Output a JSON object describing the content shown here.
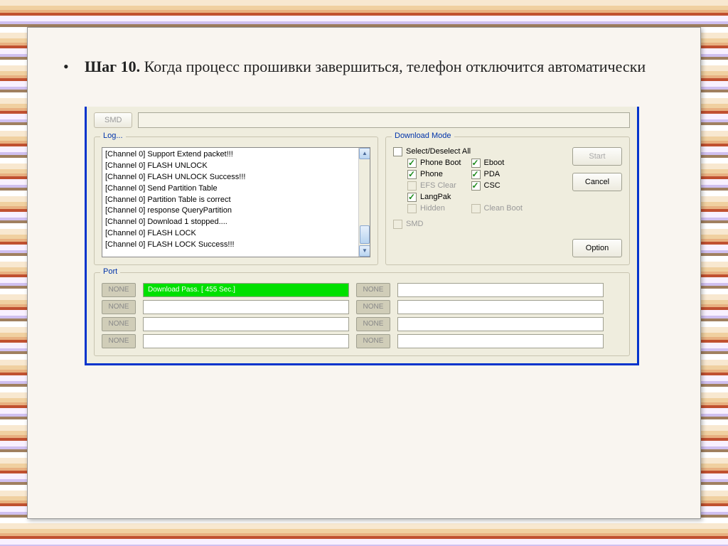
{
  "heading": {
    "bold": "Шаг 10.",
    "rest": " Когда процесс прошивки завершиться, телефон отключится автоматически"
  },
  "smd": {
    "button": "SMD"
  },
  "log": {
    "title": "Log...",
    "lines": [
      "[Channel 0] Support Extend packet!!!",
      "[Channel 0]  FLASH UNLOCK",
      "[Channel 0]  FLASH UNLOCK Success!!!",
      "[Channel 0]  Send Partition Table",
      "[Channel 0]  Partition Table is correct",
      "[Channel 0] response QueryPartition",
      "[Channel 0]  Download 1 stopped....",
      "[Channel 0]  FLASH LOCK",
      "[Channel 0]  FLASH LOCK Success!!!"
    ]
  },
  "download": {
    "title": "Download Mode",
    "selectAll": "Select/Deselect All",
    "col1": [
      {
        "label": "Phone Boot",
        "checked": true,
        "enabled": true
      },
      {
        "label": "Phone",
        "checked": true,
        "enabled": true
      },
      {
        "label": "EFS Clear",
        "checked": false,
        "enabled": false
      },
      {
        "label": "LangPak",
        "checked": true,
        "enabled": true
      },
      {
        "label": "Hidden",
        "checked": false,
        "enabled": false
      }
    ],
    "col2": [
      {
        "label": "Eboot",
        "checked": true,
        "enabled": true
      },
      {
        "label": "PDA",
        "checked": true,
        "enabled": true
      },
      {
        "label": "CSC",
        "checked": true,
        "enabled": true
      },
      {
        "label": "",
        "checked": false,
        "enabled": false
      },
      {
        "label": "Clean Boot",
        "checked": false,
        "enabled": false
      }
    ],
    "smdRow": {
      "label": "SMD",
      "checked": false,
      "enabled": false
    },
    "buttons": {
      "start": "Start",
      "cancel": "Cancel",
      "option": "Option"
    }
  },
  "port": {
    "title": "Port",
    "labels": [
      "NONE",
      "NONE",
      "NONE",
      "NONE"
    ],
    "labels2": [
      "NONE",
      "NONE",
      "NONE",
      "NONE"
    ],
    "passText": "Download Pass. [ 455 Sec.]"
  }
}
